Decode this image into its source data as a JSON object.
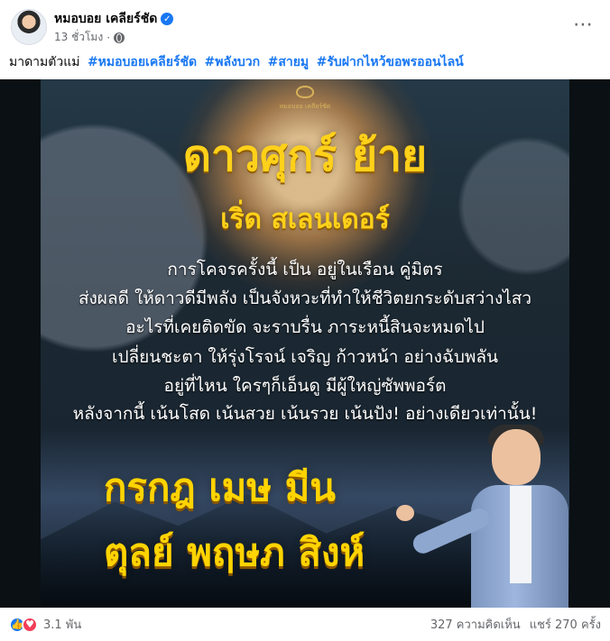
{
  "post": {
    "author_name": "หมอบอย เคลียร์ชัด",
    "time": "13 ชั่วโมง",
    "caption_prefix": "มาดามตัวแม่",
    "hashtags": [
      "#หมอบอยเคลียร์ชัด",
      "#พลังบวก",
      "#สายมู",
      "#รับฝากไหว้ขอพรออนไลน์"
    ],
    "icons": {
      "verified": "verified-icon",
      "privacy": "globe-icon",
      "more": "more-options-icon",
      "like": "like-icon",
      "love": "love-icon"
    },
    "colors": {
      "link": "#1877f2",
      "gold": "#ffd11a",
      "meta": "#65676b"
    }
  },
  "poster": {
    "brand_name": "หมอบอย เคลียร์ชัด",
    "title": "ดาวศุกร์ ย้าย",
    "subtitle": "เริ่ด สเลนเดอร์",
    "body": [
      "การโคจรครั้งนี้ เป็น อยู่ในเรือน คู่มิตร",
      "ส่งผลดี ให้ดาวดีมีพลัง เป็นจังหวะที่ทำให้ชีวิตยกระดับสว่างไสว",
      "อะไรที่เคยติดขัด จะราบรื่น ภาระหนี้สินจะหมดไป",
      "เปลี่ยนชะตา ให้รุ่งโรจน์ เจริญ ก้าวหน้า อย่างฉับพลัน",
      "อยู่ที่ไหน ใครๆก็เอ็นดู มีผู้ใหญ่ซัพพอร์ต",
      "หลังจากนี้ เน้นโสด เน้นสวย เน้นรวย เน้นปัง! อย่างเดียวเท่านั้น!"
    ],
    "zodiac_lines": [
      "กรกฎ เมษ มีน",
      "ตุลย์ พฤษภ สิงห์"
    ]
  },
  "footer": {
    "reactions_count": "3.1 พัน",
    "comments": "327 ความคิดเห็น",
    "shares": "แชร์ 270 ครั้ง"
  }
}
